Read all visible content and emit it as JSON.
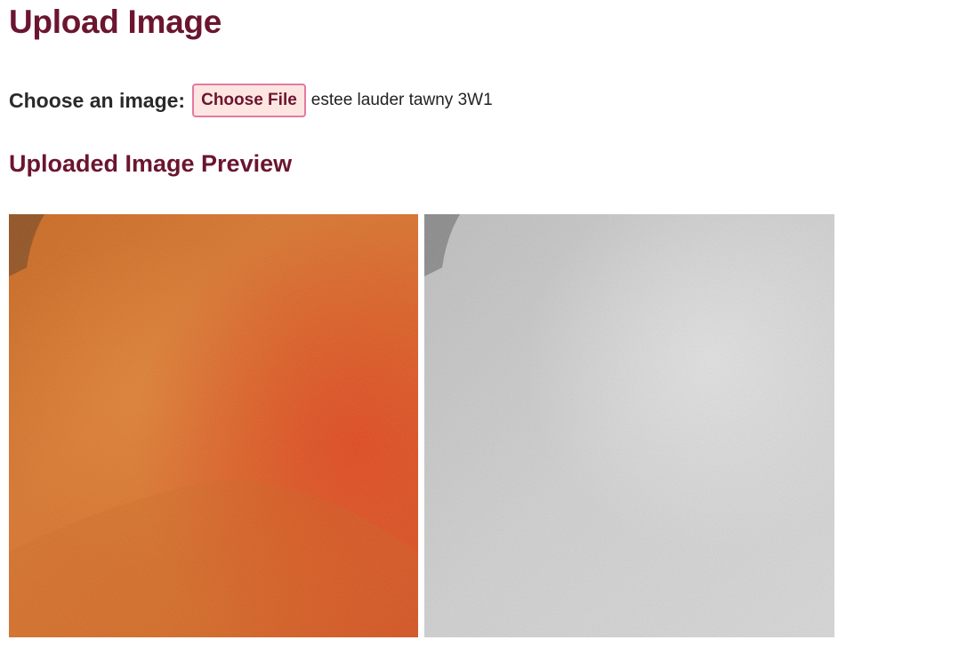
{
  "page": {
    "title": "Upload Image"
  },
  "upload": {
    "label": "Choose an image:",
    "button_label": "Choose File",
    "file_name": "estee lauder tawny 3W1"
  },
  "preview": {
    "heading": "Uploaded Image Preview",
    "images": [
      {
        "name": "color-skin-preview",
        "mode": "color",
        "dominant_color": "#d9702c"
      },
      {
        "name": "grayscale-skin-preview",
        "mode": "grayscale",
        "dominant_color": "#cfcfcf"
      }
    ]
  }
}
